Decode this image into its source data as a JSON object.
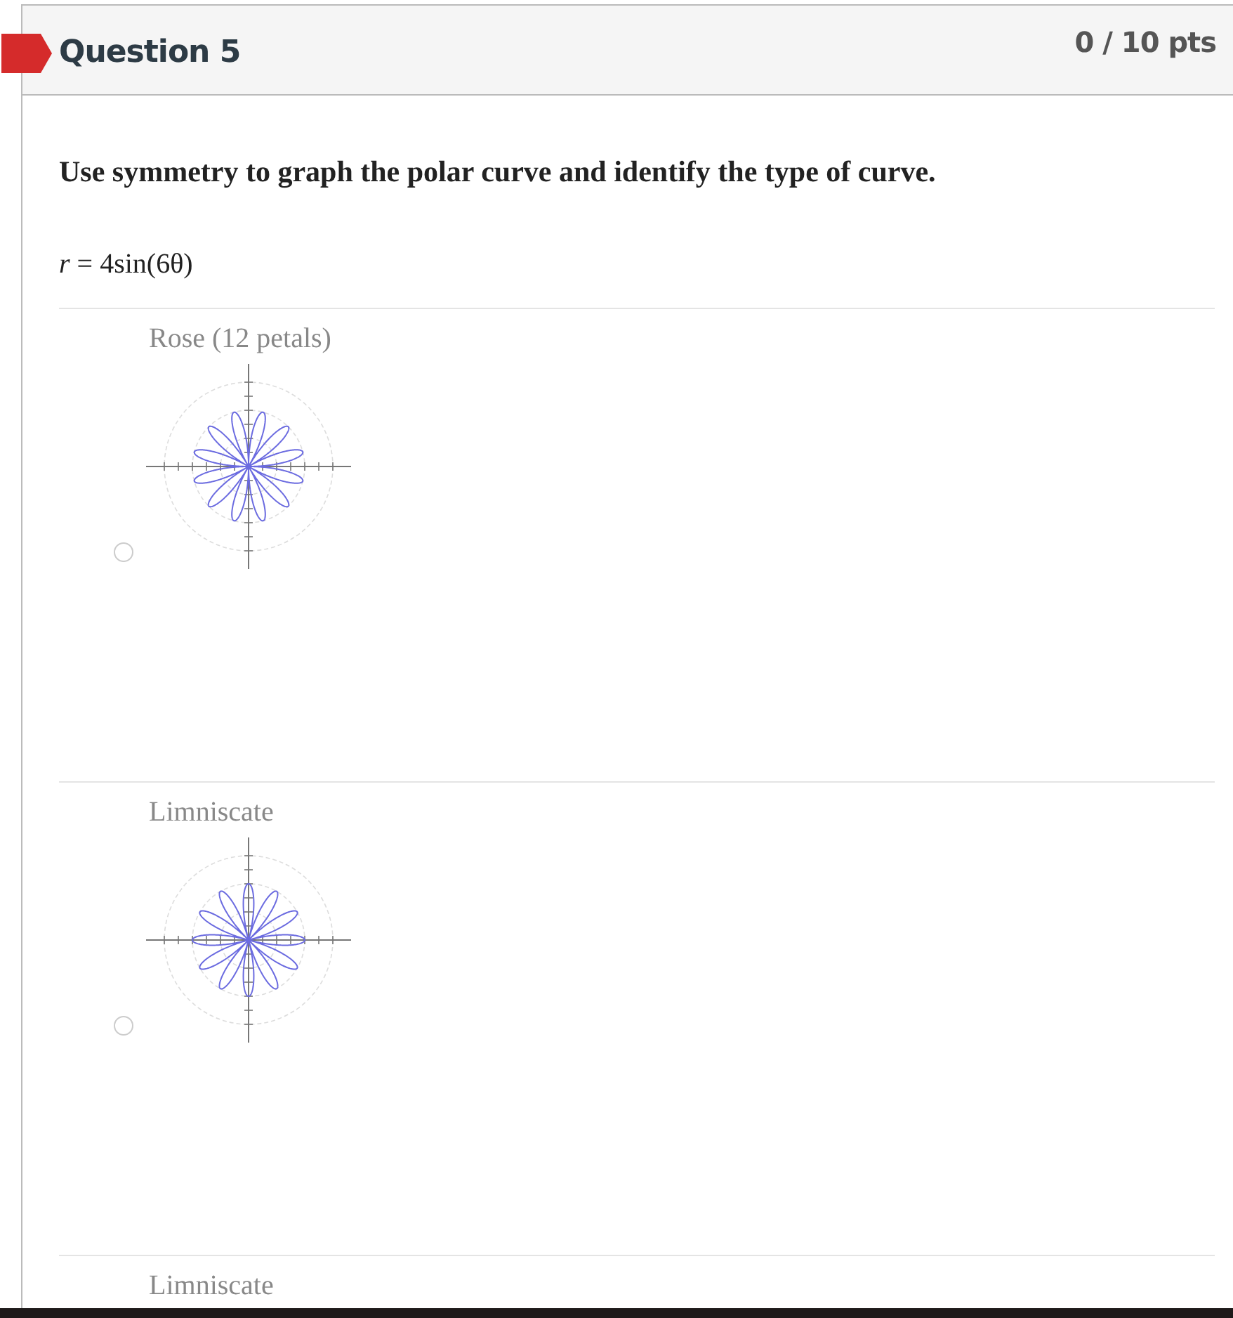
{
  "question": {
    "title": "Question 5",
    "points": "0 / 10 pts",
    "prompt": "Use symmetry to graph the polar curve and identify the type of curve.",
    "equation": "*r* = 4sin(6θ)"
  },
  "options": [
    {
      "label": "Rose (12 petals)",
      "selected": false,
      "kind": "sine-rose"
    },
    {
      "label": "Limniscate",
      "selected": false,
      "kind": "cosine-rose"
    },
    {
      "label": "Limniscate"
    }
  ]
}
